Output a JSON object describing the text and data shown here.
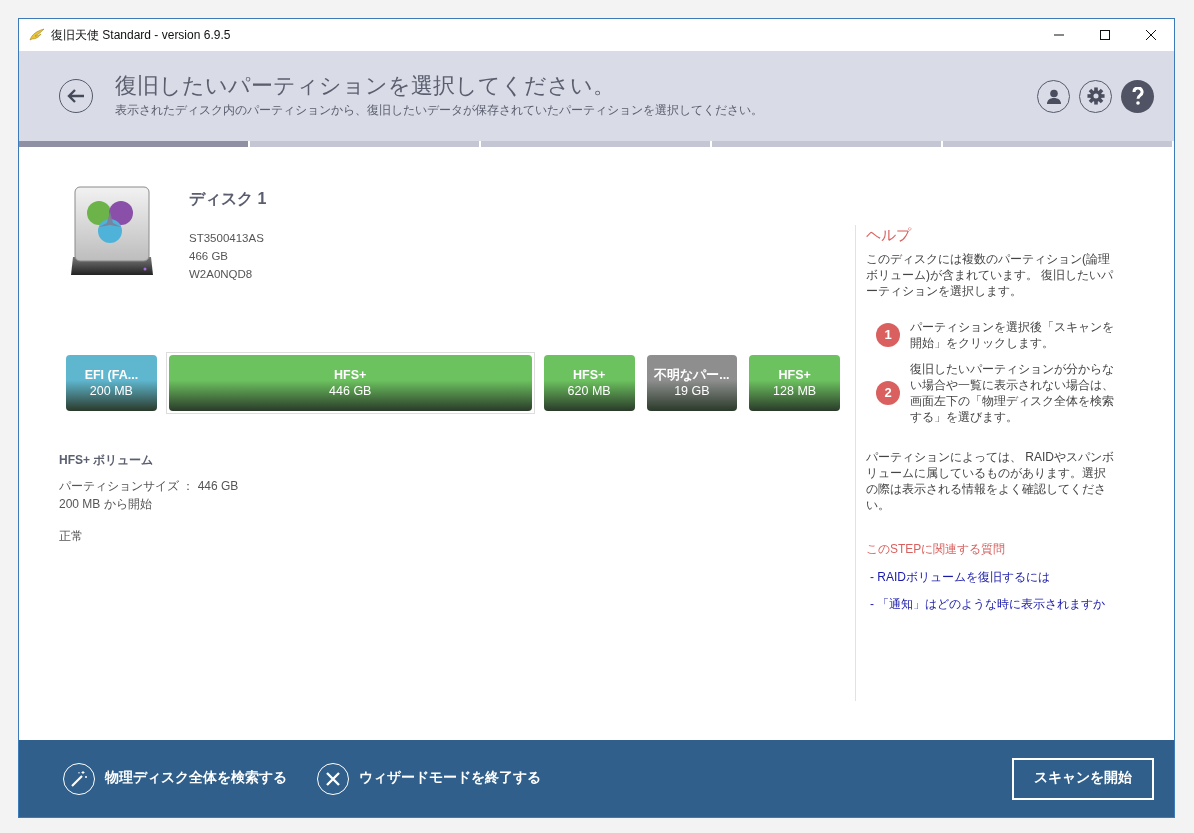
{
  "window": {
    "title": "復旧天使 Standard - version 6.9.5"
  },
  "header": {
    "title": "復旧したいパーティションを選択してください。",
    "subtitle": "表示されたディスク内のパーティションから、復旧したいデータが保存されていたパーティションを選択してください。"
  },
  "steps": [
    {
      "done": true
    },
    {
      "done": false
    },
    {
      "done": false
    },
    {
      "done": false
    },
    {
      "done": false
    }
  ],
  "disk": {
    "name": "ディスク 1",
    "model": "ST3500413AS",
    "size": "466 GB",
    "serial": "W2A0NQD8"
  },
  "partitions": [
    {
      "name": "EFI (FA...",
      "size": "200 MB",
      "color": "#5fb6cf",
      "selected": false
    },
    {
      "name": "HFS+",
      "size": "446 GB",
      "color": "#6cc25e",
      "selected": true
    },
    {
      "name": "HFS+",
      "size": "620 MB",
      "color": "#6cc25e",
      "selected": false
    },
    {
      "name": "不明なパー...",
      "size": "19 GB",
      "color": "#8e8e8e",
      "selected": false
    },
    {
      "name": "HFS+",
      "size": "128 MB",
      "color": "#6cc25e",
      "selected": false
    }
  ],
  "details": {
    "title": "HFS+ ボリューム",
    "size": "パーティションサイズ ： 446 GB",
    "start": "200 MB から開始",
    "status": "正常"
  },
  "help": {
    "title": "ヘルプ",
    "intro": "このディスクには複数のパーティション(論理ボリューム)が含まれています。 復旧したいパーティションを選択します。",
    "steps": [
      {
        "number": "1",
        "text": "パーティションを選択後「スキャンを開始」をクリックします。"
      },
      {
        "number": "2",
        "text": "復旧したいパーティションが分からない場合や一覧に表示されない場合は、画面左下の「物理ディスク全体を検索する」を選びます。"
      }
    ],
    "note": "パーティションによっては、 RAIDやスパンボリュームに属しているものがあります。選択の際は表示される情報をよく確認してください。",
    "faq_title": "このSTEPに関連する質問",
    "faq": [
      "- RAIDボリュームを復旧するには",
      "- 「通知」はどのような時に表示されますか"
    ]
  },
  "footer": {
    "search_disk": "物理ディスク全体を検索する",
    "exit_wizard": "ウィザードモードを終了する",
    "start_scan": "スキャンを開始"
  }
}
